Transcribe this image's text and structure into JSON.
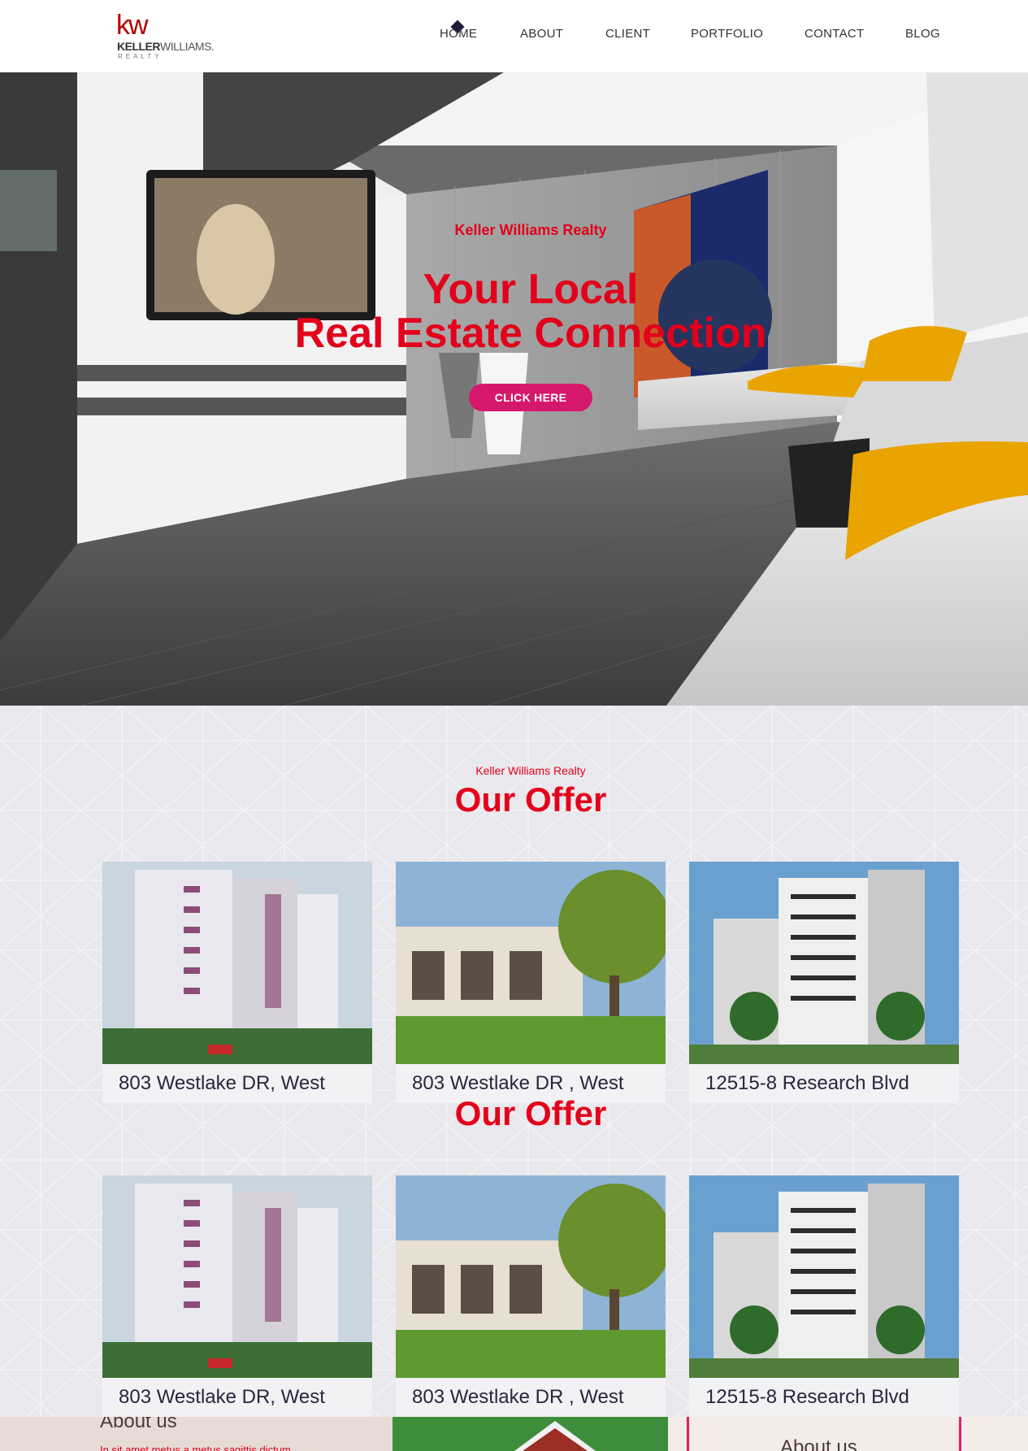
{
  "header": {
    "logo": {
      "mark": "kw",
      "name_bold": "KELLER",
      "name_rest": "WILLIAMS.",
      "sub": "REALTY"
    },
    "nav": [
      {
        "label": "HOME",
        "active": true
      },
      {
        "label": "ABOUT"
      },
      {
        "label": "CLIENT"
      },
      {
        "label": "PORTFOLIO"
      },
      {
        "label": "CONTACT"
      },
      {
        "label": "BLOG"
      }
    ]
  },
  "hero": {
    "eyebrow": "Keller Williams Realty",
    "title_line1": "Your Local",
    "title_line2": "Real Estate Connection",
    "cta_label": "CLICK HERE"
  },
  "offer": {
    "eyebrow": "Keller Williams Realty",
    "title": "Our Offer",
    "title_repeat": "Our Offer",
    "cards_row1": [
      {
        "address": "803 Westlake DR, West",
        "image": "tower-building-image"
      },
      {
        "address": "803 Westlake DR , West",
        "image": "villa-image"
      },
      {
        "address": "12515-8 Research Blvd",
        "image": "highrise-image"
      }
    ],
    "cards_row2": [
      {
        "address": "803 Westlake DR, West",
        "image": "tower-building-image"
      },
      {
        "address": "803 Westlake DR , West",
        "image": "villa-image"
      },
      {
        "address": "12515-8 Research Blvd",
        "image": "highrise-image"
      }
    ]
  },
  "about": {
    "left_heading": "About us",
    "left_text": "In sit amet metus a metus sagittis dictum.",
    "right_heading": "About us"
  },
  "colors": {
    "brand_red": "#e3001b",
    "cta_pink": "#d6186b",
    "nav_text": "#333333",
    "section_bg": "#e9e8ec"
  }
}
